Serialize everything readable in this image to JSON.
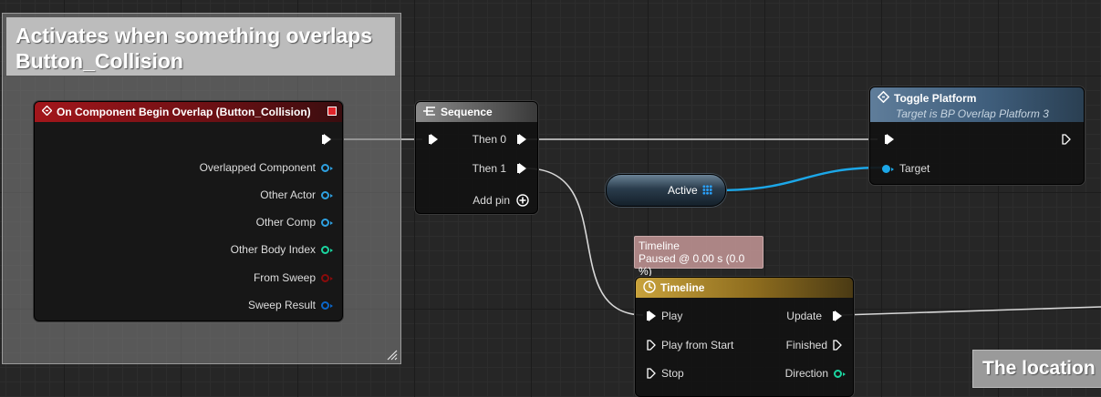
{
  "comment": {
    "title": "Activates when something overlaps Button_Collision"
  },
  "comment2": {
    "title": "The location"
  },
  "overlap_node": {
    "title": "On Component Begin Overlap (Button_Collision)",
    "pins": [
      {
        "label": "Overlapped Component",
        "color": "#2ea0e0"
      },
      {
        "label": "Other Actor",
        "color": "#2ea0e0"
      },
      {
        "label": "Other Comp",
        "color": "#2ea0e0"
      },
      {
        "label": "Other Body Index",
        "color": "#1bd5a0"
      },
      {
        "label": "From Sweep",
        "color": "#8a0b0b"
      },
      {
        "label": "Sweep Result",
        "color": "#0b66c8"
      }
    ]
  },
  "sequence_node": {
    "title": "Sequence",
    "then0": "Then 0",
    "then1": "Then 1",
    "add_pin": "Add pin"
  },
  "toggle_node": {
    "title": "Toggle Platform",
    "subtitle": "Target is BP Overlap Platform 3",
    "target": "Target"
  },
  "active_var": {
    "label": "Active"
  },
  "timeline_bubble": {
    "line1": "Timeline",
    "line2": "Paused @ 0.00 s (0.0 %)"
  },
  "timeline_node": {
    "title": "Timeline",
    "play": "Play",
    "play_from_start": "Play from Start",
    "stop": "Stop",
    "update": "Update",
    "finished": "Finished",
    "direction": "Direction"
  },
  "colors": {
    "exec_wire": "#d8d8d8",
    "object_wire": "#1ca7e8",
    "event_header": "#a3161b",
    "function_header": "#5f7d9a",
    "timeline_header": "#c8a23c"
  }
}
